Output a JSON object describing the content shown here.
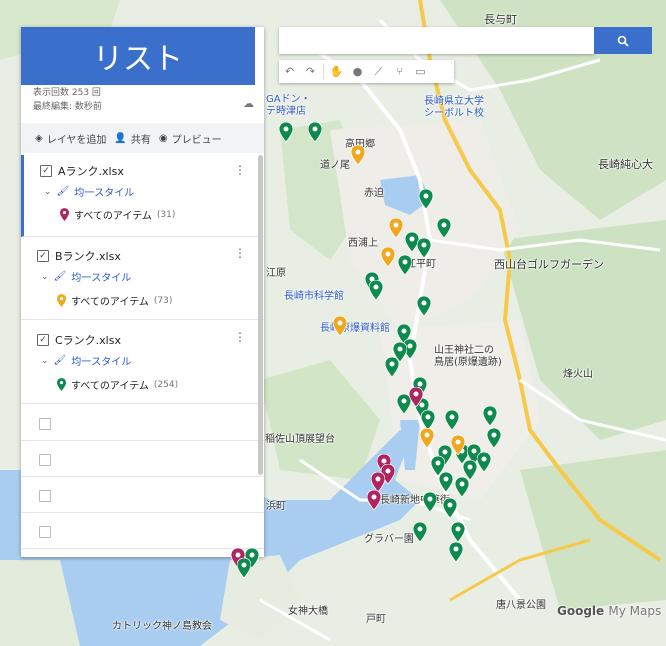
{
  "banner": {
    "title": "リスト"
  },
  "map_meta": {
    "line1": "表示回数 253 回",
    "line2": "最終編集: 数秒前"
  },
  "actions": {
    "add_layer": "レイヤを追加",
    "share": "共有",
    "preview": "プレビュー"
  },
  "layers": [
    {
      "name": "Aランク.xlsx",
      "style": "均一スタイル",
      "items": "すべてのアイテム",
      "count": "(31)",
      "color": "#b0245f"
    },
    {
      "name": "Bランク.xlsx",
      "style": "均一スタイル",
      "items": "すべてのアイテム",
      "count": "(73)",
      "color": "#f0a81e"
    },
    {
      "name": "Cランク.xlsx",
      "style": "均一スタイル",
      "items": "すべてのアイテム",
      "count": "(254)",
      "color": "#0f8a4e"
    }
  ],
  "search": {
    "placeholder": ""
  },
  "toolbar_icons": [
    "undo-icon",
    "redo-icon",
    "hand-icon",
    "marker-icon",
    "draw-line-icon",
    "route-icon",
    "measure-icon"
  ],
  "map_labels": {
    "l1": "長与町",
    "l2": "長崎県立大学",
    "l3": "シーボルト校",
    "l4": "高田郷",
    "l5": "道ノ尾",
    "l6": "赤迫",
    "l7": "西浦上",
    "l8": "長崎市科学館",
    "l9": "長崎原爆資料館",
    "l10": "山王神社二の",
    "l11": "鳥居(原爆遺跡)",
    "l12": "西山台ゴルフガーデン",
    "l13": "長崎純心大",
    "l14": "烽火山",
    "l15": "稲佐山頂展望台",
    "l16": "長崎新地中華街",
    "l17": "グラバー園",
    "l18": "女神大橋",
    "l19": "唐八景公園",
    "l20": "カトリック神ノ島教会",
    "l21": "GAドン・",
    "l22": "テ時津店",
    "l23": "江平町",
    "l24": "江原",
    "l25": "戸町",
    "l26": "浜町"
  },
  "logo": {
    "google": "Google",
    "my_maps": "My Maps"
  },
  "colors": {
    "accent": "#3a6fcc",
    "rank_a": "#b0245f",
    "rank_b": "#f0a81e",
    "rank_c": "#0f8a4e"
  }
}
